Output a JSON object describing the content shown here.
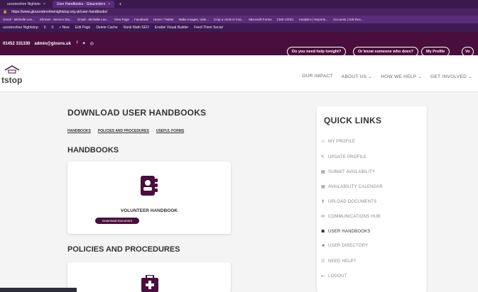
{
  "browser": {
    "tabs": [
      {
        "label": "ucestershire Nightsto",
        "active": false
      },
      {
        "label": "User Handbooks - Gloucesters",
        "active": true
      }
    ],
    "new_tab": "+",
    "url": "https://www.gloucestershirenightstop.org.uk/user-handbooks/",
    "bookmarks": [
      "Gmail - Michelle Lee...",
      "Shrewe - Service Sta...",
      "Gmail - Michelle Lee...",
      "View Page",
      "Facebook",
      "Home / Twitter",
      "Make Images, Vide...",
      "Crop a circle in Ima...",
      "Microsoft Forms",
      "CMS CRSC",
      "Analytics | Reports...",
      "Accounts | GW Rec..."
    ]
  },
  "admin_bar": {
    "items": [
      "ucestershire Nightstop",
      "0",
      "0",
      "+ New",
      "Edit Page",
      "Delete Cache",
      "Rank Math SEO",
      "Enable Visual Builder",
      "Feed Them Social"
    ]
  },
  "site_bar": {
    "phone": "01452 331330",
    "email": "admin@glosns.uk",
    "pills": [
      "Do you need help tonight?",
      "Or know someone who does?",
      "My Profile",
      "Vo"
    ]
  },
  "header": {
    "logo_text": "tstop",
    "nav": [
      "OUR IMPACT",
      "ABOUT US ⌄",
      "HOW WE HELP ⌄",
      "GET INVOLVED ⌄"
    ]
  },
  "main": {
    "title": "DOWNLOAD USER HANDBOOKS",
    "subnav": [
      "HANDBOOKS",
      "POLICIES AND PROCEDURES",
      "USEFUL FORMS"
    ],
    "section1": "HANDBOOKS",
    "card1_title": "VOLUNTEER HANDBOOK",
    "card1_button": "Download Document",
    "section2": "POLICIES AND PROCEDURES"
  },
  "sidebar": {
    "title": "QUICK LINKS",
    "items": [
      {
        "label": "MY PROFILE",
        "icon": "user-icon",
        "glyph": "☺"
      },
      {
        "label": "UPDATE PROFILE",
        "icon": "user-edit-icon",
        "glyph": "✎"
      },
      {
        "label": "SUBMIT AVAILABILITY",
        "icon": "calendar-icon",
        "glyph": "▦"
      },
      {
        "label": "AVAILABILITY CALENDAR",
        "icon": "calendar-grid-icon",
        "glyph": "▦"
      },
      {
        "label": "UPLOAD DOCUMENTS",
        "icon": "upload-icon",
        "glyph": "⬆"
      },
      {
        "label": "COMMUNICATIONS HUB",
        "icon": "chat-icon",
        "glyph": "✉"
      },
      {
        "label": "USER HANDBOOKS",
        "icon": "book-icon",
        "glyph": "☗"
      },
      {
        "label": "USER DIRECTORY",
        "icon": "users-icon",
        "glyph": "☻"
      },
      {
        "label": "NEED HELP?",
        "icon": "help-icon",
        "glyph": "☷"
      },
      {
        "label": "LOGOUT",
        "icon": "logout-icon",
        "glyph": "⇤"
      }
    ]
  },
  "colors": {
    "brand": "#4a0e3c",
    "browser_chrome": "#3a1a4e"
  }
}
